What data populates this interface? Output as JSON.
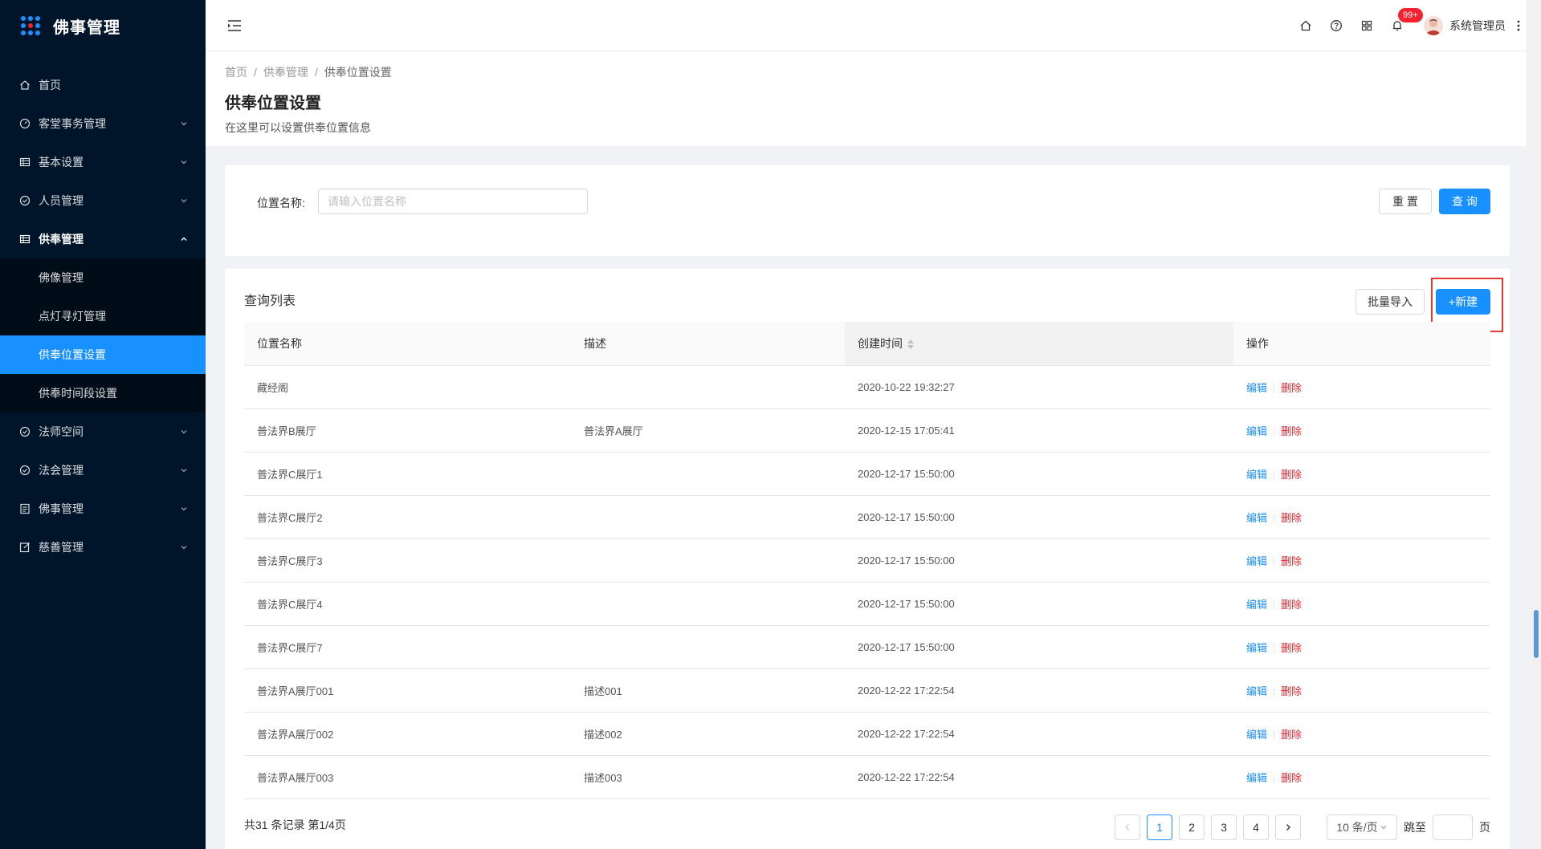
{
  "app": {
    "title": "佛事管理"
  },
  "sidebar": {
    "items": [
      {
        "label": "首页",
        "icon": "home-icon"
      },
      {
        "label": "客堂事务管理",
        "icon": "dashboard-icon"
      },
      {
        "label": "基本设置",
        "icon": "table-icon"
      },
      {
        "label": "人员管理",
        "icon": "check-circle-icon"
      },
      {
        "label": "供奉管理",
        "icon": "table-icon"
      },
      {
        "label": "法师空间",
        "icon": "check-circle-icon"
      },
      {
        "label": "法会管理",
        "icon": "check-circle-icon"
      },
      {
        "label": "佛事管理",
        "icon": "profile-icon"
      },
      {
        "label": "慈善管理",
        "icon": "form-icon"
      }
    ],
    "submenu": [
      {
        "label": "佛像管理"
      },
      {
        "label": "点灯寻灯管理"
      },
      {
        "label": "供奉位置设置"
      },
      {
        "label": "供奉时间段设置"
      }
    ]
  },
  "header": {
    "notification_count": "99+",
    "user_name": "系统管理员"
  },
  "page": {
    "breadcrumb": [
      "首页",
      "供奉管理",
      "供奉位置设置"
    ],
    "title": "供奉位置设置",
    "description": "在这里可以设置供奉位置信息"
  },
  "search": {
    "label": "位置名称:",
    "placeholder": "请输入位置名称",
    "value": "",
    "reset_label": "重 置",
    "query_label": "查 询"
  },
  "list": {
    "title": "查询列表",
    "import_label": "批量导入",
    "new_label": "+新建",
    "columns": [
      "位置名称",
      "描述",
      "创建时间",
      "操作"
    ],
    "edit_label": "编辑",
    "delete_label": "删除",
    "rows": [
      {
        "name": "藏经阁",
        "desc": "",
        "created": "2020-10-22 19:32:27"
      },
      {
        "name": "普法界B展厅",
        "desc": "普法界A展厅",
        "created": "2020-12-15 17:05:41"
      },
      {
        "name": "普法界C展厅1",
        "desc": "",
        "created": "2020-12-17 15:50:00"
      },
      {
        "name": "普法界C展厅2",
        "desc": "",
        "created": "2020-12-17 15:50:00"
      },
      {
        "name": "普法界C展厅3",
        "desc": "",
        "created": "2020-12-17 15:50:00"
      },
      {
        "name": "普法界C展厅4",
        "desc": "",
        "created": "2020-12-17 15:50:00"
      },
      {
        "name": "普法界C展厅7",
        "desc": "",
        "created": "2020-12-17 15:50:00"
      },
      {
        "name": "普法界A展厅001",
        "desc": "描述001",
        "created": "2020-12-22 17:22:54"
      },
      {
        "name": "普法界A展厅002",
        "desc": "描述002",
        "created": "2020-12-22 17:22:54"
      },
      {
        "name": "普法界A展厅003",
        "desc": "描述003",
        "created": "2020-12-22 17:22:54"
      }
    ]
  },
  "pagination": {
    "total_text": "共31 条记录 第1/4页",
    "pages": [
      "1",
      "2",
      "3",
      "4"
    ],
    "current": "1",
    "page_size": "10 条/页",
    "jump_label": "跳至",
    "page_unit": "页"
  },
  "colors": {
    "sidebar_bg": "#001529",
    "accent": "#1890ff",
    "danger": "#f5222d"
  }
}
